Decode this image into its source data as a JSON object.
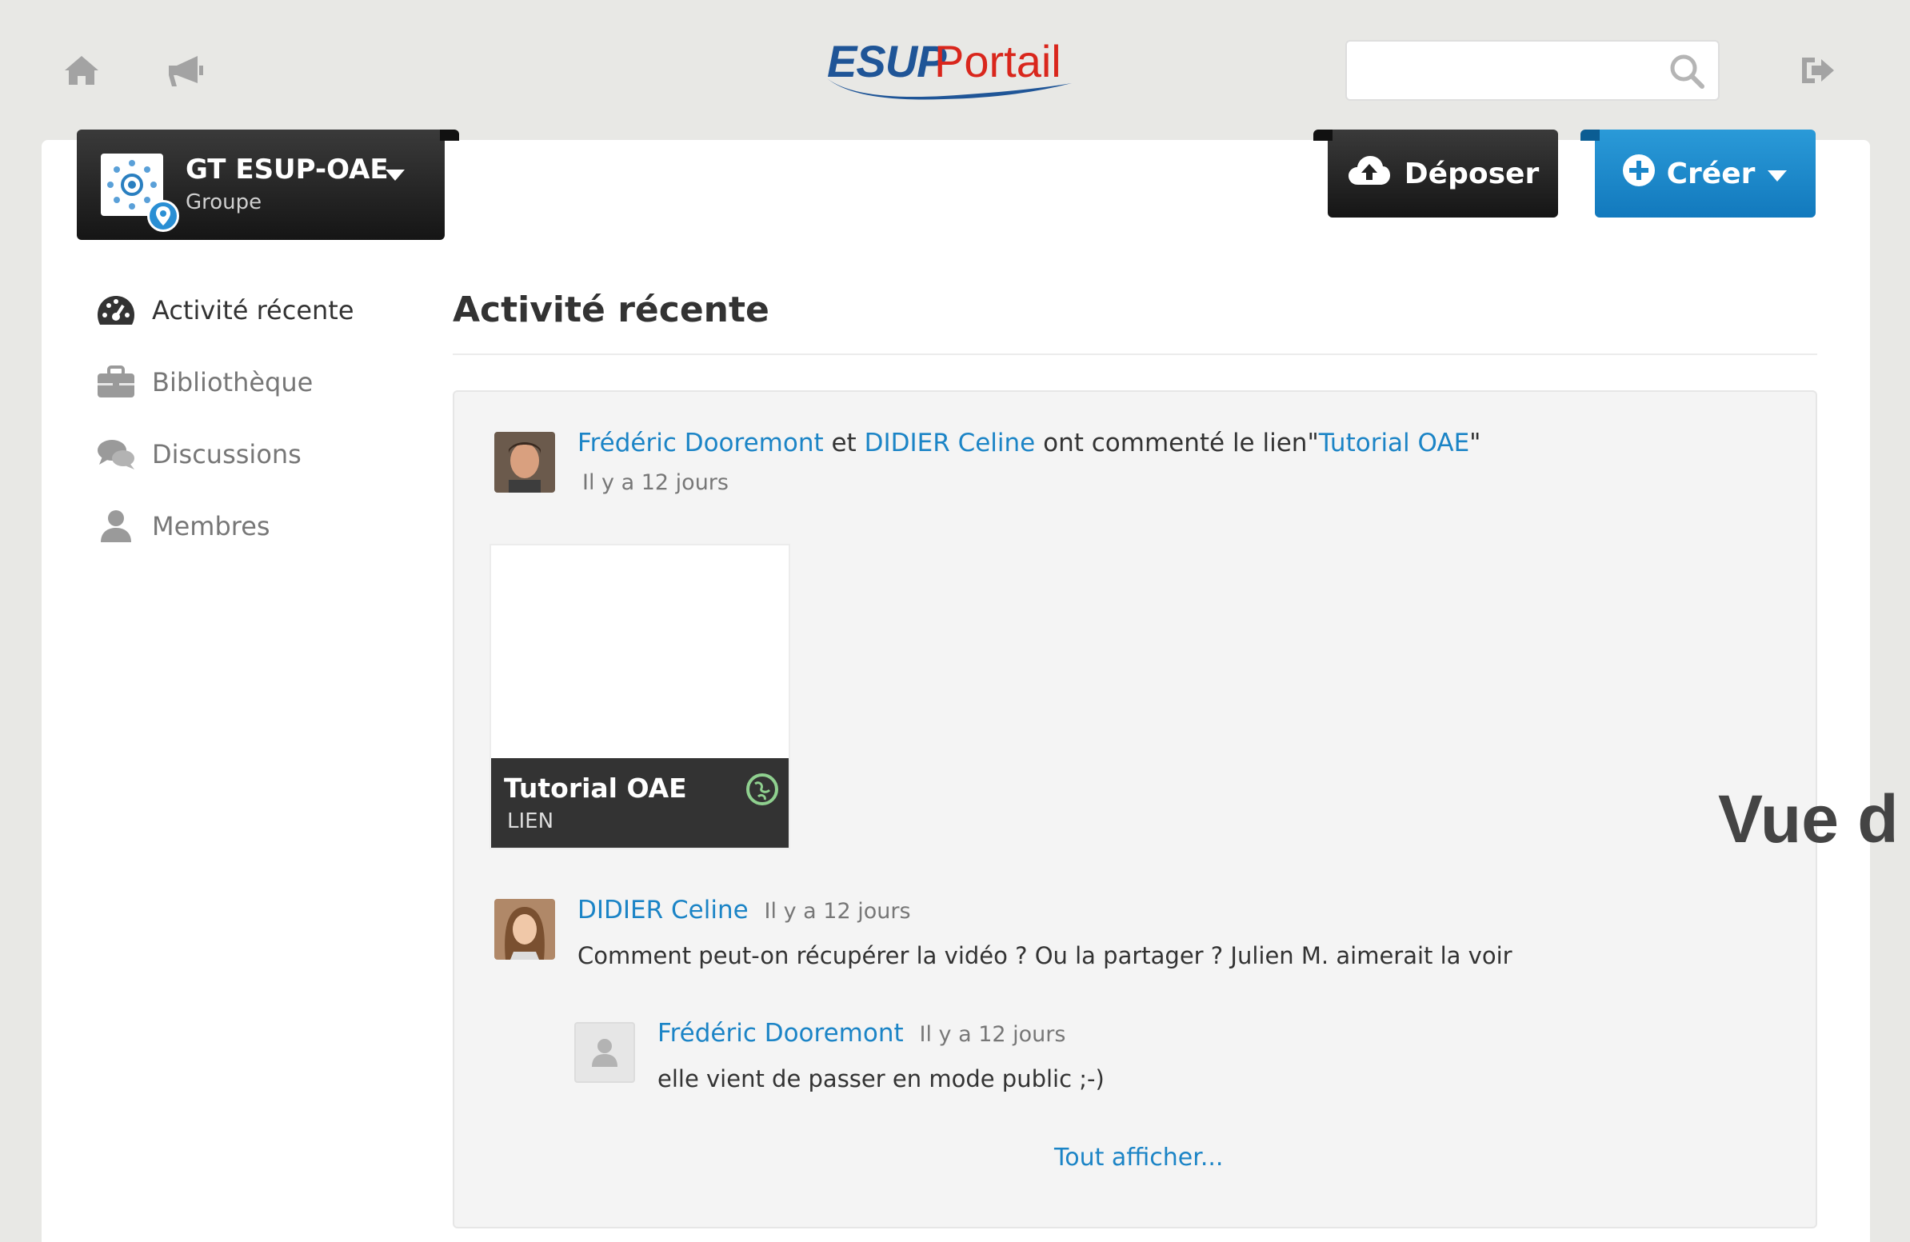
{
  "brand": {
    "logo_primary": "ESUP",
    "logo_secondary": "Portail",
    "primary_color": "#1f5597",
    "secondary_color": "#d9261c"
  },
  "topbar": {
    "home_icon": "home-icon",
    "announce_icon": "megaphone-icon",
    "search": {
      "value": "",
      "placeholder": ""
    },
    "logout_icon": "sign-out-icon"
  },
  "group": {
    "name": "GT ESUP-OAE",
    "type": "Groupe"
  },
  "actions": {
    "upload_label": "Déposer",
    "create_label": "Créer",
    "accent": "#1b84c6"
  },
  "sidebar": {
    "items": [
      {
        "label": "Activité récente",
        "icon": "dashboard-icon",
        "active": true
      },
      {
        "label": "Bibliothèque",
        "icon": "briefcase-icon",
        "active": false
      },
      {
        "label": "Discussions",
        "icon": "comments-icon",
        "active": false
      },
      {
        "label": "Membres",
        "icon": "user-icon",
        "active": false
      }
    ]
  },
  "main": {
    "title": "Activité récente",
    "activity": {
      "actor1": "Frédéric Dooremont",
      "conj": "et",
      "actor2": "DIDIER Celine",
      "verb": "ont commenté le lien",
      "quote_open": "\"",
      "object": "Tutorial OAE",
      "quote_close": "\"",
      "time": "Il y a 12 jours",
      "tile": {
        "title": "Tutorial OAE",
        "type": "LIEN"
      },
      "comments": [
        {
          "author": "DIDIER Celine",
          "time": "Il y a 12 jours",
          "text": "Comment peut-on récupérer la vidéo ? Ou la partager ? Julien M. aimerait la voir"
        },
        {
          "author": "Frédéric Dooremont",
          "time": "Il y a 12 jours",
          "text": "elle vient de passer en mode public ;-)"
        }
      ],
      "show_all": "Tout afficher..."
    }
  },
  "overlay": {
    "text": "Vue d"
  }
}
